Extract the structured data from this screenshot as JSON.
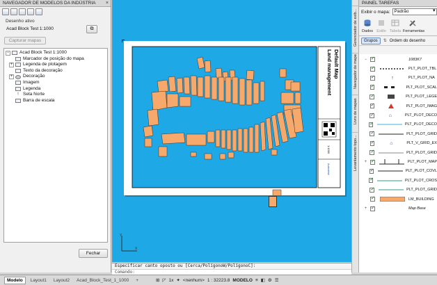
{
  "left_panel": {
    "title": "NAVEGADOR DE MODELOS DA INDÚSTRIA",
    "close_glyph": "×",
    "drawing_label": "Desenho ativo",
    "drawing_value": "Acad Block Test 1:1000",
    "capture_button": "Capturar mapas",
    "close_button": "Fechar",
    "tree": [
      {
        "label": "Acad Block Test 1:1000",
        "expander": "−",
        "icon": "layout-icon",
        "indent": 0
      },
      {
        "label": "Marcador de posição do mapa",
        "expander": "",
        "icon": "map-placeholder-icon",
        "indent": 1
      },
      {
        "label": "Legenda de plotagem",
        "expander": "+",
        "icon": "legend-icon",
        "indent": 1
      },
      {
        "label": "Texto da decoração",
        "expander": "",
        "icon": "text-icon",
        "indent": 1
      },
      {
        "label": "Decoração",
        "expander": "+",
        "icon": "decoration-icon",
        "indent": 1
      },
      {
        "label": "Imagem",
        "expander": "",
        "icon": "image-icon",
        "indent": 1
      },
      {
        "label": "Legenda",
        "expander": "",
        "icon": "legend-icon",
        "indent": 1
      },
      {
        "label": "Seta Norte",
        "expander": "",
        "icon": "north-arrow-icon",
        "indent": 1
      },
      {
        "label": "Barra de escala",
        "expander": "",
        "icon": "scale-bar-icon",
        "indent": 1
      }
    ]
  },
  "canvas": {
    "sheet_title_line1": "Land management",
    "sheet_title_line2": "Default Map",
    "sheet_scale_text": "1:1000",
    "sheet_brand": "Autodesk",
    "prompt_text": "Especificar canto oposto ou [Cerca/PolígonoW/PolígonoC]:",
    "command_label": "Comando:",
    "colors": {
      "background": "#1ea8e6",
      "buildings": "#f6a96b",
      "building_stroke": "#333333"
    }
  },
  "layout_tabs": [
    {
      "label": "Modelo",
      "active": true
    },
    {
      "label": "Layout1",
      "active": false
    },
    {
      "label": "Layout2",
      "active": false
    },
    {
      "label": "Acad_Block_Test_1_1000",
      "active": false
    },
    {
      "label": "+",
      "active": false
    }
  ],
  "status_bar": {
    "snap": "1x",
    "annotation": "<nenhum>",
    "scale": "1 : 32223.8",
    "model": "MODELO"
  },
  "vertical_tabs": [
    "Gerenciador de exib...",
    "Navegador de mapa",
    "Livro de mapas",
    "Levantamento topo..."
  ],
  "task_pane": {
    "title": "PAINEL TAREFAS",
    "map_label": "Exibir o mapa:",
    "map_value": "Padrão",
    "tools": [
      {
        "label": "Dados",
        "disabled": false
      },
      {
        "label": "Estilo",
        "disabled": true
      },
      {
        "label": "Tabela",
        "disabled": true
      },
      {
        "label": "Ferramentas",
        "disabled": false
      }
    ],
    "view_group_button": "Grupos",
    "view_order_button": "Ordem do desenho",
    "layers": [
      {
        "label": "1083K7",
        "style": "group",
        "italic": true,
        "exp": "−"
      },
      {
        "label": "PLT_PLOT_TBL",
        "style": "dashes",
        "italic": false,
        "exp": ""
      },
      {
        "label": "PLT_PLOT_NA",
        "style": "arrow",
        "italic": false,
        "exp": ""
      },
      {
        "label": "PLT_PLOT_SCAL",
        "style": "scalebar",
        "italic": false,
        "exp": ""
      },
      {
        "label": "PLT_PLOT_LEGE",
        "style": "legendblock",
        "italic": false,
        "exp": ""
      },
      {
        "label": "PLT_PLOT_IMAG",
        "style": "redtriangle",
        "italic": false,
        "exp": ""
      },
      {
        "label": "PLT_PLOT_DECO",
        "style": "bluemark",
        "italic": false,
        "exp": ""
      },
      {
        "label": "PLT_PLOT_DECO",
        "style": "cyanline",
        "italic": false,
        "exp": ""
      },
      {
        "label": "PLT_PLOT_GRID",
        "style": "blackline",
        "italic": false,
        "exp": ""
      },
      {
        "label": "PLT_V_GRID_EX",
        "style": "bluemark",
        "italic": false,
        "exp": ""
      },
      {
        "label": "PLT_PLOT_GRID",
        "style": "greyline",
        "italic": false,
        "exp": ""
      },
      {
        "label": "PLT_PLOT_MAP",
        "style": "mapframe",
        "italic": false,
        "exp": "+"
      },
      {
        "label": "PLT_PLOT_COVL",
        "style": "blackline",
        "italic": false,
        "exp": ""
      },
      {
        "label": "PLT_PLOT_CROS",
        "style": "tealline",
        "italic": false,
        "exp": ""
      },
      {
        "label": "PLT_PLOT_GRID",
        "style": "tealline",
        "italic": false,
        "exp": ""
      },
      {
        "label": "LM_BUILDING",
        "style": "orangefill",
        "italic": false,
        "exp": ""
      },
      {
        "label": "Map Base",
        "style": "group",
        "italic": true,
        "exp": "+"
      }
    ]
  }
}
